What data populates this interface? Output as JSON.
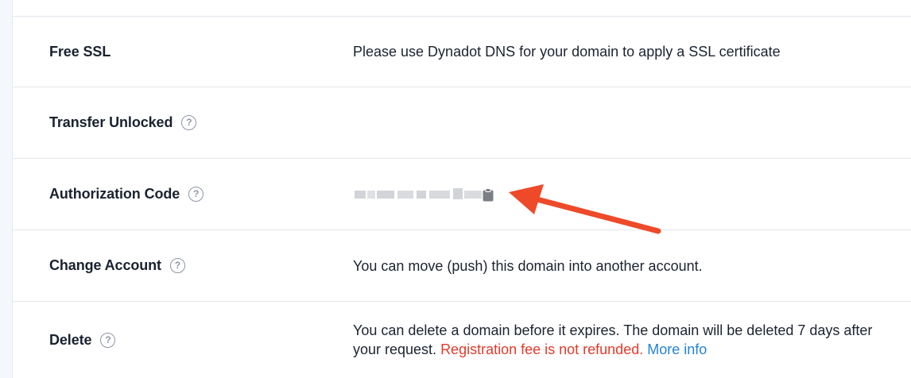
{
  "rows": {
    "free_ssl": {
      "label": "Free SSL",
      "value": "Please use Dynadot DNS for your domain to apply a SSL certificate"
    },
    "transfer_unlocked": {
      "label": "Transfer Unlocked",
      "help": "?"
    },
    "authorization_code": {
      "label": "Authorization Code",
      "help": "?",
      "copy_icon": "clipboard-icon"
    },
    "change_account": {
      "label": "Change Account",
      "help": "?",
      "value": "You can move (push) this domain into another account."
    },
    "delete": {
      "label": "Delete",
      "help": "?",
      "value_part1": "You can delete a domain before it expires. The domain will be deleted 7 days after your request. ",
      "value_warning": "Registration fee is not refunded.",
      "more_info": "More info"
    }
  },
  "colors": {
    "warning": "#e23a2b",
    "link": "#2383d6",
    "annotation_arrow": "#ee4a2a"
  }
}
